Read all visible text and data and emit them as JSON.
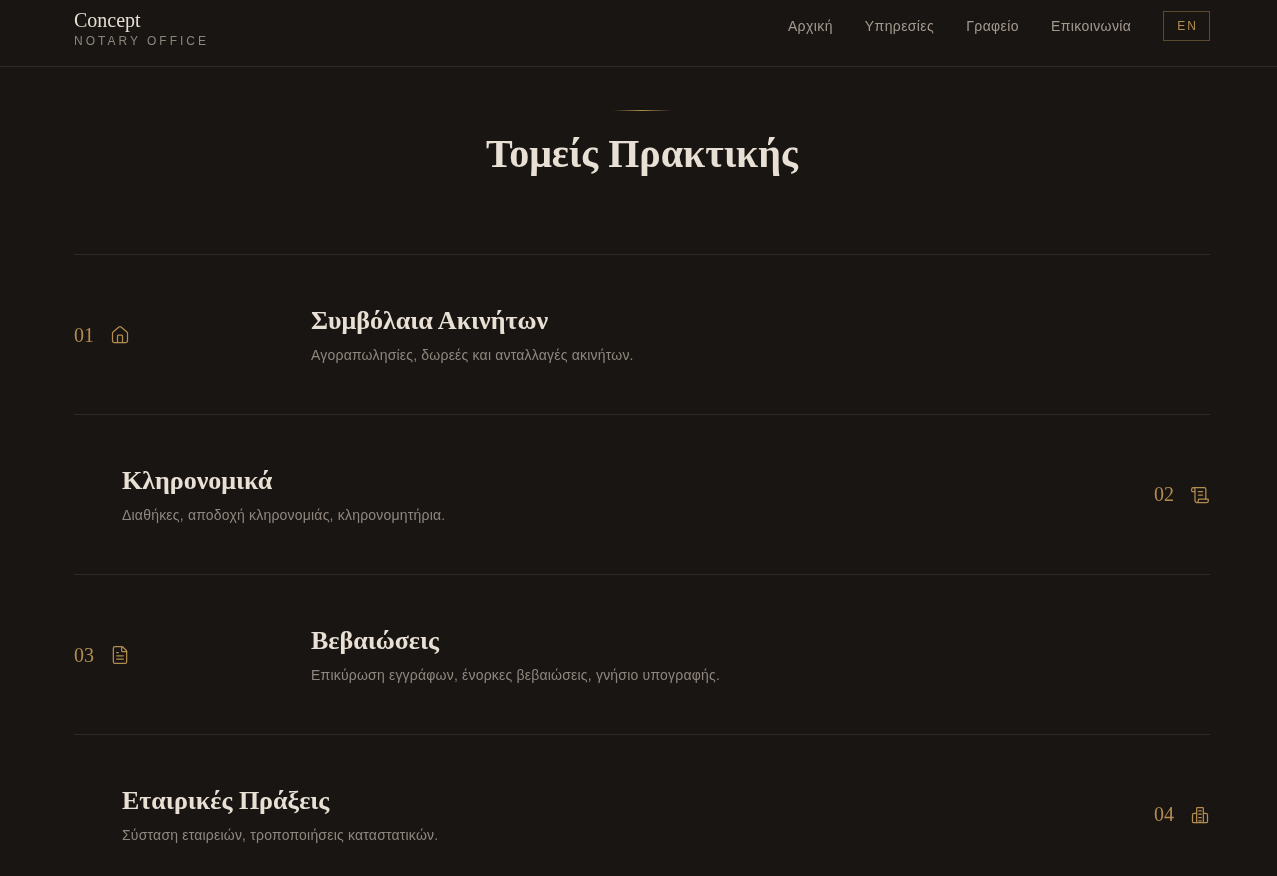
{
  "header": {
    "logo": {
      "title": "Concept",
      "subtitle": "NOTARY OFFICE"
    },
    "nav": [
      {
        "label": "Αρχική"
      },
      {
        "label": "Υπηρεσίες"
      },
      {
        "label": "Γραφείο"
      },
      {
        "label": "Επικοινωνία"
      }
    ],
    "language_button": "EN"
  },
  "section": {
    "title": "Τομείς Πρακτικής",
    "practice_areas": [
      {
        "number": "01",
        "title": "Συμβόλαια Ακινήτων",
        "description": "Αγοραπωλησίες, δωρεές και ανταλλαγές ακινήτων."
      },
      {
        "number": "02",
        "title": "Κληρονομικά",
        "description": "Διαθήκες, αποδοχή κληρονομιάς, κληρονομητήρια."
      },
      {
        "number": "03",
        "title": "Βεβαιώσεις",
        "description": "Επικύρωση εγγράφων, ένορκες βεβαιώσεις, γνήσιο υπογραφής."
      },
      {
        "number": "04",
        "title": "Εταιρικές Πράξεις",
        "description": "Σύσταση εταιρειών, τροποποιήσεις καταστατικών."
      }
    ]
  }
}
